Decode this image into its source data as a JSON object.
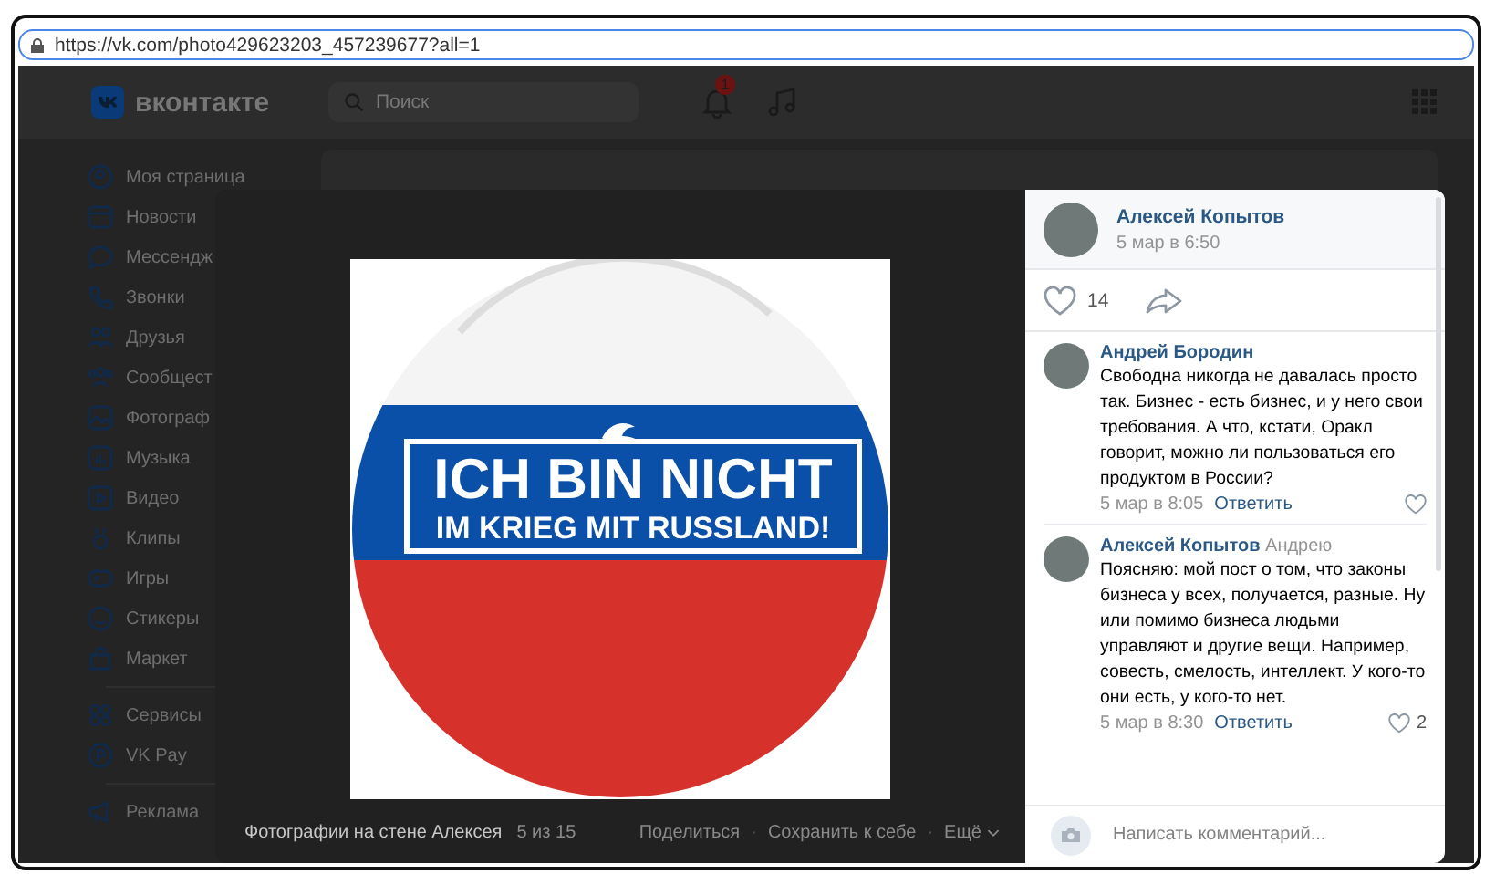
{
  "address_bar": {
    "url": "https://vk.com/photo429623203_457239677?all=1"
  },
  "header": {
    "logo": "вконтакте",
    "search": {
      "placeholder": "Поиск"
    },
    "notification_badge": "1"
  },
  "sidebar": {
    "groups": [
      {
        "items": [
          {
            "label": "Моя страница"
          },
          {
            "label": "Новости"
          },
          {
            "label": "Мессендж"
          },
          {
            "label": "Звонки"
          },
          {
            "label": "Друзья"
          },
          {
            "label": "Сообщест"
          },
          {
            "label": "Фотограф"
          },
          {
            "label": "Музыка"
          },
          {
            "label": "Видео"
          },
          {
            "label": "Клипы"
          },
          {
            "label": "Игры"
          },
          {
            "label": "Стикеры"
          },
          {
            "label": "Маркет"
          }
        ]
      },
      {
        "items": [
          {
            "label": "Сервисы"
          },
          {
            "label": "VK Pay"
          }
        ]
      },
      {
        "items": [
          {
            "label": "Реклама"
          }
        ]
      }
    ]
  },
  "viewer": {
    "photo": {
      "lines": [
        "ICH BIN NICHT",
        "IM KRIEG MIT RUSSLAND!"
      ]
    },
    "album": "Фотографии на стене Алексея",
    "counter": "5 из 15",
    "actions": [
      "Поделиться",
      "Сохранить к себе",
      "Ещё"
    ],
    "separators": [
      "·",
      "·"
    ]
  },
  "post": {
    "author": "Алексей Копытов",
    "date": "5 мар в 6:50",
    "likes": "14",
    "liked": false
  },
  "comments": [
    {
      "author": "Андрей Бородин",
      "text": "Свободна никогда не давалась просто так. Бизнес - есть бизнес, и у него свои требования. А что, кстати, Оракл говорит, можно ли пользоваться его продуктом в России?",
      "time": "5 мар в 8:05",
      "reply": "Ответить",
      "liked": false
    },
    {
      "author": "Алексей Копытов",
      "reply_to": "Андрею",
      "text": "Поясняю: мой пост о том, что законы бизнеса у всех, получается, разные. Ну или помимо бизнеса людьми управляют и другие вещи. Например, совесть, смелость, интеллект. У кого-то они есть, у кого-то нет.",
      "time": "5 мар в 8:30",
      "reply": "Ответить",
      "likes": "2",
      "liked": false
    }
  ],
  "comment_input": {
    "placeholder": "Написать комментарий..."
  }
}
